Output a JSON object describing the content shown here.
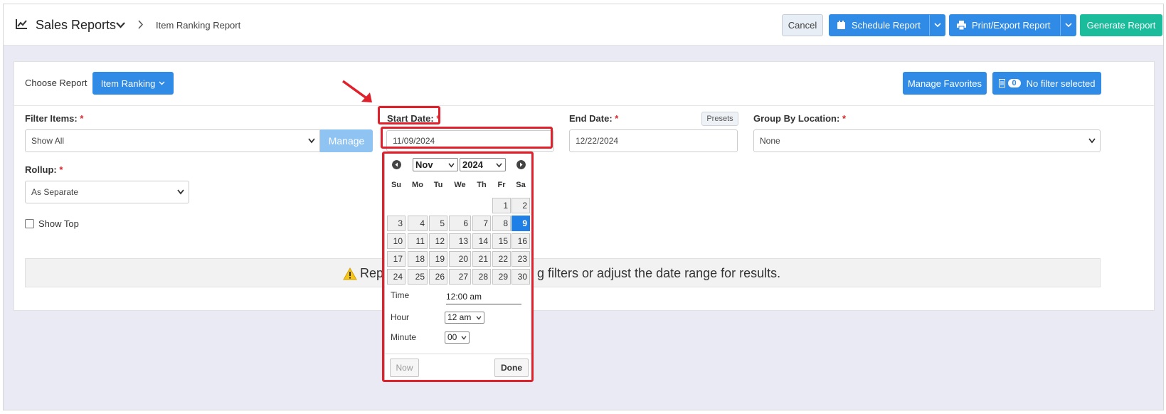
{
  "header": {
    "app_title": "Sales Reports",
    "breadcrumb_current": "Item Ranking Report",
    "cancel_label": "Cancel",
    "schedule_label": "Schedule Report",
    "print_label": "Print/Export Report",
    "generate_label": "Generate Report"
  },
  "toolbar": {
    "choose_report_label": "Choose Report",
    "report_selected": "Item Ranking",
    "manage_favorites_label": "Manage Favorites",
    "filter_count": "0",
    "filter_label": "No filter selected"
  },
  "filters": {
    "filter_items_label": "Filter Items:",
    "filter_items_value": "Show All",
    "manage_label": "Manage",
    "start_date_label": "Start Date:",
    "start_date_value": "11/09/2024",
    "end_date_label": "End Date:",
    "end_date_value": "12/22/2024",
    "presets_label": "Presets",
    "group_by_label": "Group By Location:",
    "group_by_value": "None",
    "rollup_label": "Rollup:",
    "rollup_value": "As Separate",
    "show_top_label": "Show Top",
    "required_mark": "*"
  },
  "alert": {
    "text_left": "Repo",
    "text_right": "g filters or adjust the date range for results."
  },
  "datepicker": {
    "month": "Nov",
    "year": "2024",
    "weekdays": [
      "Su",
      "Mo",
      "Tu",
      "We",
      "Th",
      "Fr",
      "Sa"
    ],
    "days": [
      "1",
      "2",
      "3",
      "4",
      "5",
      "6",
      "7",
      "8",
      "9",
      "10",
      "11",
      "12",
      "13",
      "14",
      "15",
      "16",
      "17",
      "18",
      "19",
      "20",
      "21",
      "22",
      "23",
      "24",
      "25",
      "26",
      "27",
      "28",
      "29",
      "30"
    ],
    "selected_day": "9",
    "time_label": "Time",
    "time_value": "12:00 am",
    "hour_label": "Hour",
    "hour_value": "12 am",
    "minute_label": "Minute",
    "minute_value": "00",
    "now_label": "Now",
    "done_label": "Done"
  },
  "colors": {
    "primary": "#2f8be6",
    "generate": "#1abc9c",
    "highlight": "#e0202a",
    "selected_day": "#1e7fe6",
    "background": "#e9eaf3"
  }
}
